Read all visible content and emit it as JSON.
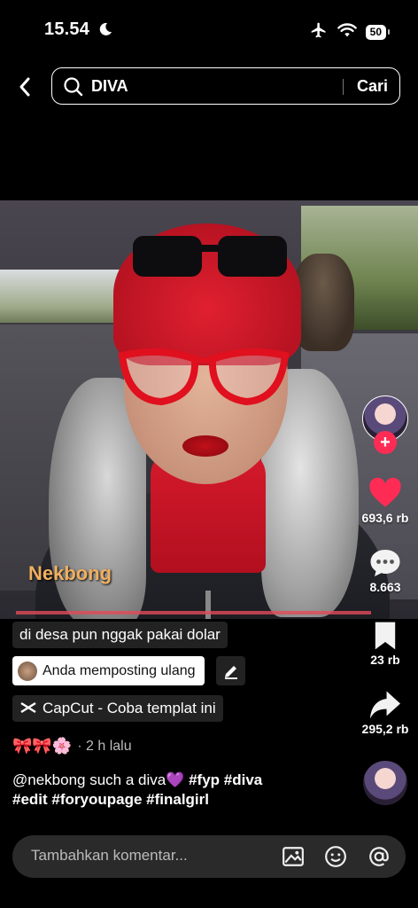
{
  "status_bar": {
    "time": "15.54",
    "battery": "50",
    "icons": [
      "moon-icon",
      "airplane-icon",
      "wifi-icon",
      "battery-icon"
    ]
  },
  "search": {
    "query": "DIVA",
    "submit_label": "Cari"
  },
  "video": {
    "watermark": "Nekbong",
    "progress": 0.85
  },
  "actions": {
    "like_count": "693,6 rb",
    "comment_count": "8.663",
    "bookmark_count": "23 rb",
    "share_count": "295,2 rb"
  },
  "caption": {
    "sound_title": "di desa pun nggak pakai dolar",
    "repost_label": "Anda memposting ulang",
    "capcut_label": "CapCut - Coba templat ini",
    "emojis": "🎀🎀🌸",
    "time_ago": "· 2 h lalu",
    "description_mention": "@nekbong such a diva💜",
    "description_tags_line1": " #fyp #diva",
    "description_tags_line2": "#edit #foryoupage #finalgirl"
  },
  "comment": {
    "placeholder": "Tambahkan komentar..."
  },
  "colors": {
    "like": "#fe2c55",
    "follow": "#fe2c55",
    "background": "#000000",
    "pill": "#222222"
  }
}
